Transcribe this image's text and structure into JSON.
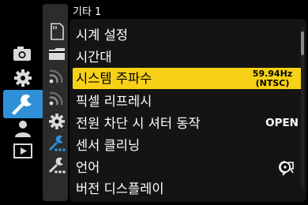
{
  "menu": {
    "title": "기타 1",
    "items": [
      {
        "label": "시계 설정",
        "value": ""
      },
      {
        "label": "시간대",
        "value": ""
      },
      {
        "label": "시스템 주파수",
        "value_line1": "59.94Hz",
        "value_line2": "(NTSC)",
        "selected": true
      },
      {
        "label": "픽셀 리프레시",
        "value": ""
      },
      {
        "label": "전원 차단 시 셔터 동작",
        "value": "OPEN"
      },
      {
        "label": "센서 클리닝",
        "value": ""
      },
      {
        "label": "언어",
        "value_icon": "language-icon"
      },
      {
        "label": "버전 디스플레이",
        "value": ""
      }
    ]
  },
  "categories": [
    {
      "icon": "camera-icon"
    },
    {
      "icon": "gear-icon"
    },
    {
      "icon": "wrench-icon",
      "active": true
    },
    {
      "icon": "person-icon"
    },
    {
      "icon": "playback-icon"
    }
  ],
  "tabs": [
    {
      "icon": "card-icon"
    },
    {
      "icon": "folder-icon"
    },
    {
      "icon": "wireless-1-icon"
    },
    {
      "icon": "wireless-2-icon"
    },
    {
      "icon": "gear-icon"
    },
    {
      "icon": "wrench-dots-icon"
    },
    {
      "icon": "wrench-dots-icon"
    }
  ],
  "colors": {
    "active_category": "#2f8fd7",
    "selected_row": "#f7d117",
    "tab_accent": "#2f8fd7"
  }
}
